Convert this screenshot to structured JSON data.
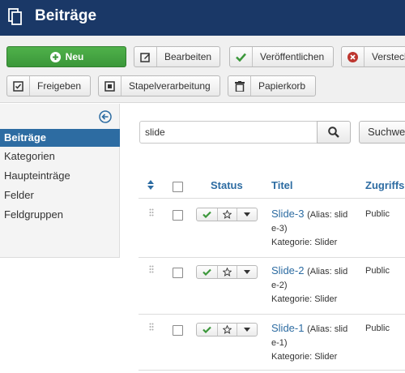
{
  "header": {
    "title": "Beiträge",
    "icon": "copy-icon",
    "bg": "#1a3867"
  },
  "toolbar": {
    "new_label": "Neu",
    "edit_label": "Bearbeiten",
    "publish_label": "Veröffentlichen",
    "hide_label": "Versteck",
    "checkin_label": "Freigeben",
    "batch_label": "Stapelverarbeitung",
    "trash_label": "Papierkorb"
  },
  "sidebar": {
    "items": [
      {
        "label": "Beiträge",
        "active": true
      },
      {
        "label": "Kategorien",
        "active": false
      },
      {
        "label": "Haupteinträge",
        "active": false
      },
      {
        "label": "Felder",
        "active": false
      },
      {
        "label": "Feldgruppen",
        "active": false
      }
    ]
  },
  "search": {
    "value": "slide",
    "tools_label": "Suchwe"
  },
  "table": {
    "columns": {
      "status": "Status",
      "title": "Titel",
      "access": "Zugriffs"
    },
    "rows": [
      {
        "title": "Slide-3",
        "alias_a": "(Alias: slid",
        "alias_b": "e-3)",
        "category": "Kategorie: Slider",
        "access": "Public",
        "published": true
      },
      {
        "title": "Slide-2",
        "alias_a": "(Alias: slid",
        "alias_b": "e-2)",
        "category": "Kategorie: Slider",
        "access": "Public",
        "published": true
      },
      {
        "title": "Slide-1",
        "alias_a": "(Alias: slid",
        "alias_b": "e-1)",
        "category": "Kategorie: Slider",
        "access": "Public",
        "published": true
      }
    ]
  },
  "colors": {
    "accent": "#2d6ca2",
    "success": "#3b973a",
    "danger": "#bd362f"
  }
}
